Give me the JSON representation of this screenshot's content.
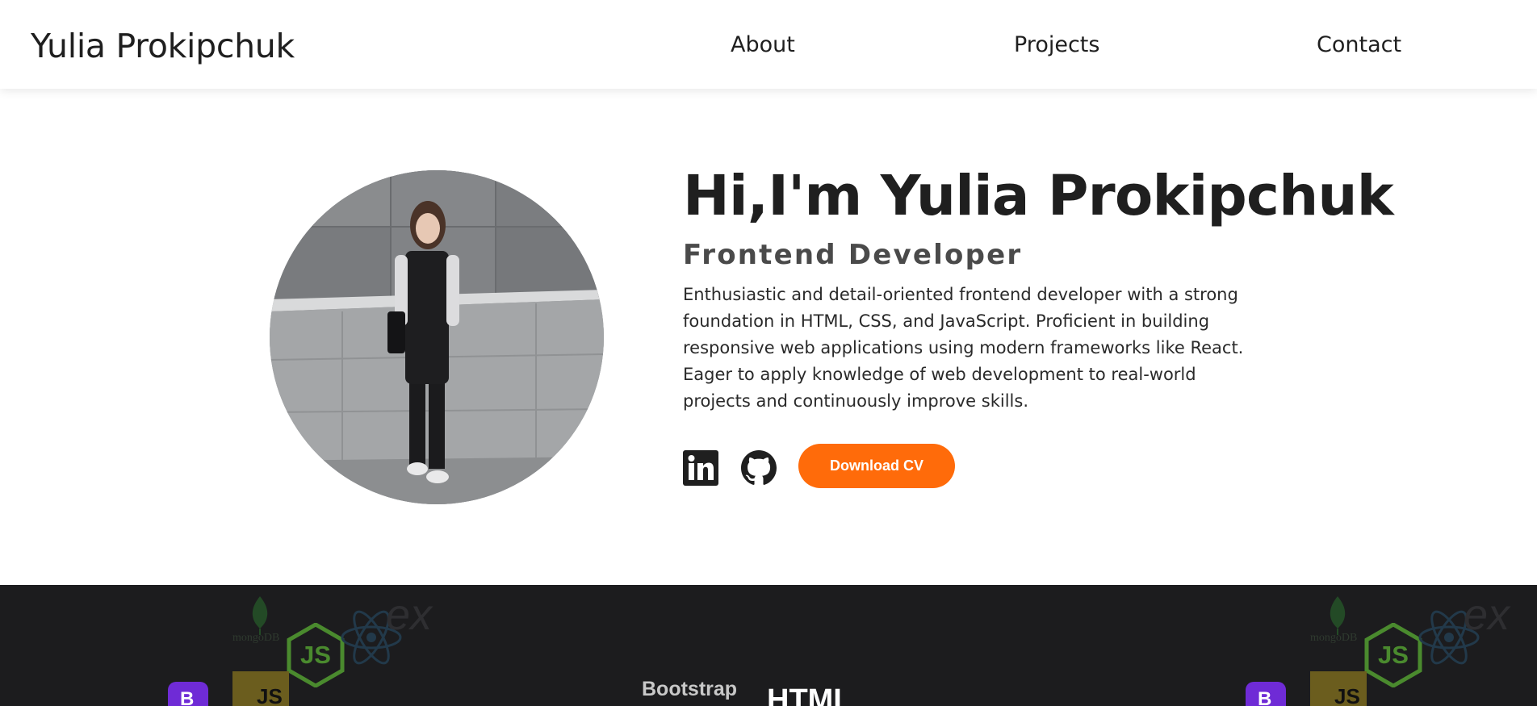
{
  "header": {
    "brand": "Yulia Prokipchuk",
    "nav": {
      "about": "About",
      "projects": "Projects",
      "contact": "Contact"
    }
  },
  "hero": {
    "photo_alt": "Yulia Prokipchuk",
    "greeting": "Hi,I'm Yulia Prokipchuk",
    "role": "Frontend Developer",
    "bio": "Enthusiastic and detail-oriented frontend developer with a strong foundation in HTML, CSS, and JavaScript. Proficient in building responsive web applications using modern frameworks like React. Eager to apply knowledge of web development to real-world projects and continuously improve skills.",
    "socials": [
      {
        "icon": "linkedin-icon"
      },
      {
        "icon": "github-icon"
      }
    ],
    "cv_button": "Download CV"
  },
  "skills": {
    "logos": [
      {
        "icon": "mongodb-icon",
        "label": "mongoDB"
      },
      {
        "icon": "nodejs-icon",
        "label": "JS"
      },
      {
        "icon": "react-icon"
      },
      {
        "icon": "express-icon",
        "label": "ex"
      },
      {
        "icon": "bootstrap-icon",
        "label": "B"
      },
      {
        "icon": "javascript-icon",
        "label": "JS"
      },
      {
        "icon": "css-icon",
        "label": "Bootstrap"
      },
      {
        "icon": "html-icon",
        "label": "HTML"
      }
    ]
  },
  "colors": {
    "accent": "#ff6b0a",
    "skills_background": "#1c1c1e",
    "text": "#1f1f1f"
  }
}
